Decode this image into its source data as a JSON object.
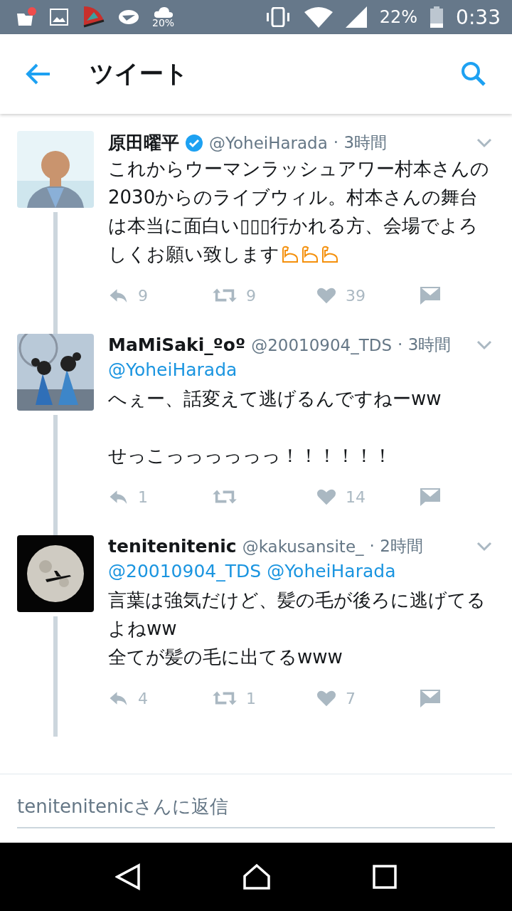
{
  "status_bar": {
    "weather": "20%",
    "battery": "22%",
    "time": "0:33"
  },
  "header": {
    "title": "ツイート"
  },
  "tweets": [
    {
      "name": "原田曜平",
      "verified": true,
      "handle": "@YoheiHarada",
      "time": "· 3時間",
      "body": "これからウーマンラッシュアワー村本さんの2030からのライブウィル。村本さんの舞台は本当に面白い▯▯▯行かれる方、会場でよろしくお願い致します",
      "emoji": [
        {
          "kind": "flexed-arm"
        },
        {
          "kind": "flexed-arm"
        },
        {
          "kind": "flexed-arm"
        }
      ],
      "avatar": {
        "kind": "picture"
      },
      "replies": "9",
      "retweets": "9",
      "likes": "39"
    },
    {
      "name": "MaMiSaki_ºoº",
      "verified": false,
      "handle": "@20010904_TDS",
      "time": "· 3時間",
      "mentions": [
        "@YoheiHarada"
      ],
      "body": "へぇー、話変えて逃げるんですねーww\n\nせっこっっっっっっ！！！！！！",
      "avatar": {
        "kind": "picture"
      },
      "replies": "1",
      "likes": "14"
    },
    {
      "name": "tenitenitenic",
      "verified": false,
      "handle": "@kakusansite_",
      "time": "· 2時間",
      "mentions": [
        "@20010904_TDS",
        "@YoheiHarada"
      ],
      "body": "言葉は強気だけど、髪の毛が後ろに逃げてるよねww\n全てが髪の毛に出てるwww",
      "avatar": {
        "kind": "picture"
      },
      "replies": "4",
      "retweets": "1",
      "likes": "7"
    }
  ],
  "reply_box": {
    "placeholder": "tenitenitenicさんに返信"
  }
}
